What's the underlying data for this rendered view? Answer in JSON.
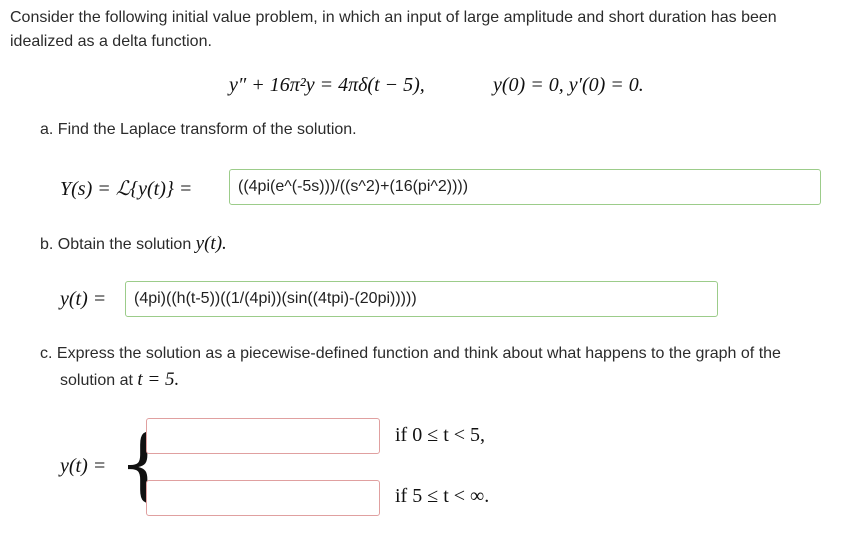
{
  "intro": {
    "line1": "Consider the following initial value problem, in which an input of large amplitude and short duration has been",
    "line2": "idealized as a delta function."
  },
  "equation": {
    "ode": "y″ + 16π²y = 4πδ(t − 5),",
    "ic": "y(0) = 0,   y′(0) = 0."
  },
  "part_a": {
    "label": "a. Find the Laplace transform of the solution.",
    "math_prefix": "Y(s) = ℒ{y(t)} =",
    "answer_value": "((4pi(e^(-5s)))/((s^2)+(16(pi^2))))"
  },
  "part_b": {
    "label_text": "b. Obtain the solution ",
    "label_math": "y(t).",
    "math_prefix": "y(t) =",
    "answer_value": "(4pi)((h(t-5))((1/(4pi))(sin((4tpi)-(20pi)))))"
  },
  "part_c": {
    "label_line1": "c. Express the solution as a piecewise-defined function and think about what happens to the graph of the",
    "label_line2_text": "solution at ",
    "label_line2_math": "t = 5.",
    "math_prefix": "y(t) =",
    "brace": "{",
    "case1_value": "",
    "case1_condition": "if  0 ≤ t < 5,",
    "case2_value": "",
    "case2_condition": "if  5 ≤ t < ∞."
  }
}
